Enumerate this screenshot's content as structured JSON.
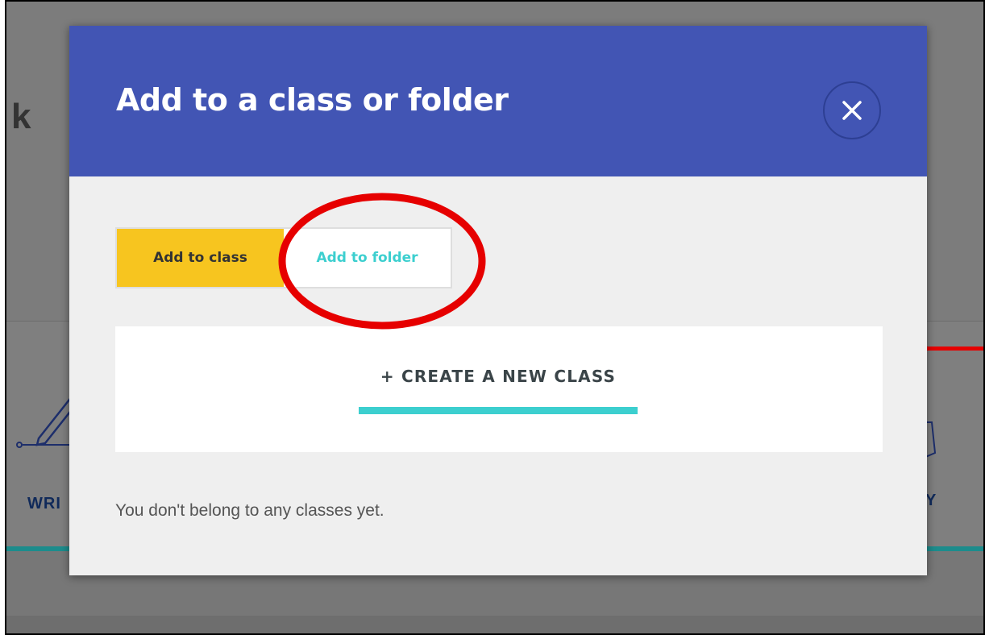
{
  "modal": {
    "title": "Add to a class or folder",
    "close_icon": "close-icon",
    "tabs": [
      {
        "label": "Add to class",
        "active": true
      },
      {
        "label": "Add to folder",
        "active": false
      }
    ],
    "create_label": "+ CREATE A NEW CLASS",
    "empty_message": "You don't belong to any classes yet."
  },
  "background": {
    "heading_glyph": "k",
    "left_label": "WRI",
    "right_label": "Y",
    "left_icon": "pencil-icon",
    "right_icon": "card-icon"
  },
  "colors": {
    "header": "#4255b4",
    "tab_active": "#f7c51f",
    "accent_teal": "#3ccfcf",
    "annotation_red": "#e60000"
  }
}
